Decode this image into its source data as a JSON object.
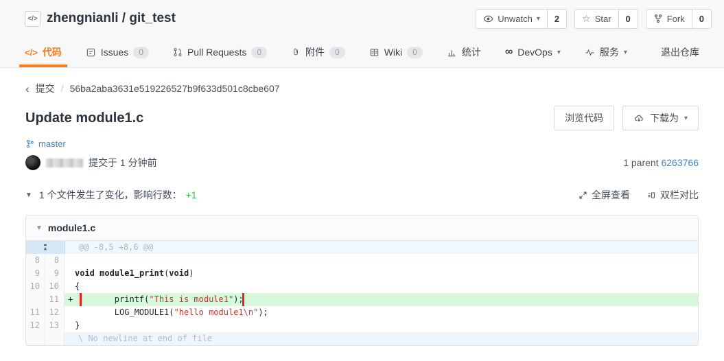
{
  "header": {
    "repo_title": "zhengnianli / git_test",
    "actions": [
      {
        "icon": "eye-icon",
        "label": "Unwatch",
        "count": "2",
        "has_caret": true
      },
      {
        "icon": "star-icon",
        "label": "Star",
        "count": "0"
      },
      {
        "icon": "fork-icon",
        "label": "Fork",
        "count": "0"
      }
    ]
  },
  "nav": {
    "tabs": [
      {
        "label": "代码",
        "active": true
      },
      {
        "label": "Issues",
        "badge": "0"
      },
      {
        "label": "Pull Requests",
        "badge": "0"
      },
      {
        "label": "附件",
        "badge": "0"
      },
      {
        "label": "Wiki",
        "badge": "0"
      },
      {
        "label": "统计"
      },
      {
        "label": "DevOps"
      },
      {
        "label": "服务"
      }
    ],
    "exit_label": "退出仓库"
  },
  "breadcrumb": {
    "back_label": "提交",
    "separator": "/",
    "commit_hash": "56ba2aba3631e519226527b9f633d501c8cbe607"
  },
  "commit": {
    "title": "Update module1.c",
    "browse_code_label": "浏览代码",
    "download_label": "下载为",
    "branch": "master",
    "commit_time_text": "提交于 1 分钟前",
    "parent_label": "1 parent",
    "parent_hash": "6263766"
  },
  "summary": {
    "text": "1 个文件发生了变化，影响行数：",
    "added": "+1",
    "fullscreen_label": "全屏查看",
    "split_label": "双栏对比"
  },
  "diff": {
    "filename": "module1.c",
    "rows": [
      {
        "type": "hunk",
        "text": "@@ -8,5 +8,6 @@"
      },
      {
        "type": "context",
        "old": "8",
        "new": "8",
        "segs": []
      },
      {
        "type": "context",
        "old": "9",
        "new": "9",
        "segs": [
          [
            "void",
            "kw"
          ],
          [
            " ",
            ""
          ],
          [
            "module1_print",
            "fn"
          ],
          [
            "(",
            ""
          ],
          [
            "void",
            "kw"
          ],
          [
            ")",
            ""
          ]
        ]
      },
      {
        "type": "context",
        "old": "10",
        "new": "10",
        "segs": [
          [
            "{",
            ""
          ]
        ]
      },
      {
        "type": "added",
        "old": "",
        "new": "11",
        "marker": "+",
        "annotated": true,
        "segs": [
          [
            "        printf(",
            ""
          ],
          [
            "\"This is module1\"",
            "str"
          ],
          [
            ");",
            ""
          ]
        ]
      },
      {
        "type": "context",
        "old": "11",
        "new": "12",
        "segs": [
          [
            "        LOG_MODULE1(",
            ""
          ],
          [
            "\"hello module1\\n\"",
            "str"
          ],
          [
            ");",
            ""
          ]
        ]
      },
      {
        "type": "context",
        "old": "12",
        "new": "13",
        "segs": [
          [
            "}",
            ""
          ]
        ]
      },
      {
        "type": "nonewline",
        "text": "\\ No newline at end of file"
      }
    ]
  }
}
